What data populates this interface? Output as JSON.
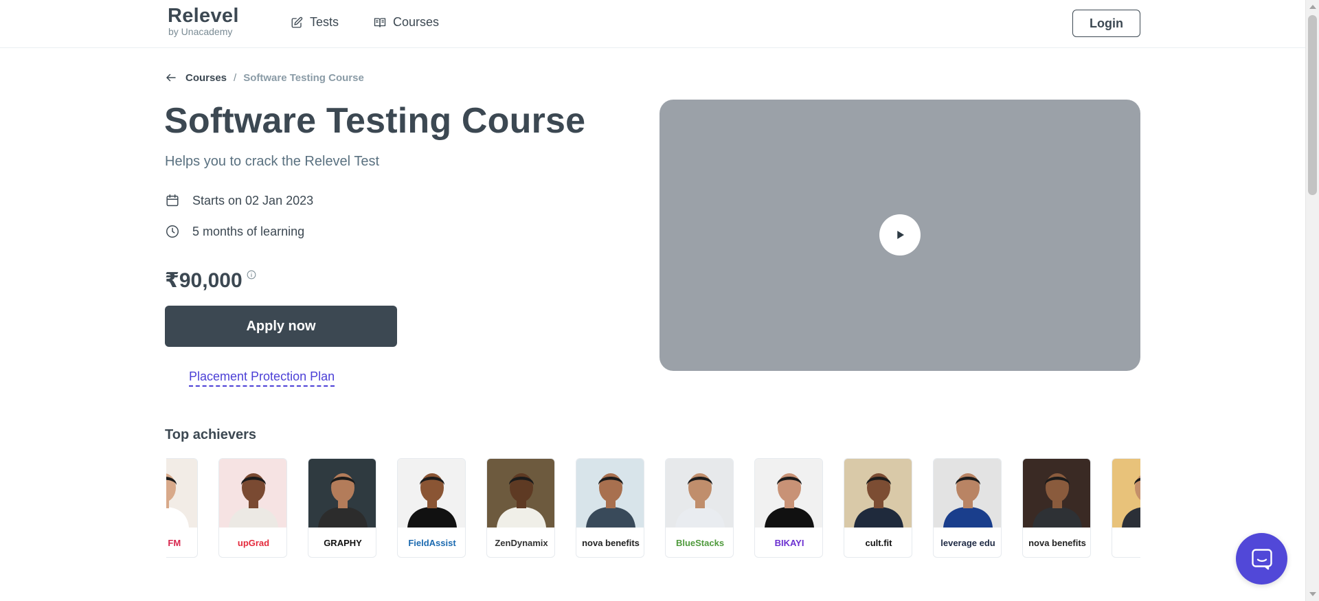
{
  "header": {
    "logo_main": "Relevel",
    "logo_sub": "by Unacademy",
    "nav": [
      {
        "label": "Tests",
        "icon": "edit-note-icon"
      },
      {
        "label": "Courses",
        "icon": "book-icon"
      }
    ],
    "login_label": "Login"
  },
  "breadcrumb": {
    "parent": "Courses",
    "separator": "/",
    "current": "Software Testing Course"
  },
  "course": {
    "title": "Software Testing Course",
    "subtitle": "Helps you to crack the Relevel Test",
    "start": "Starts on 02 Jan 2023",
    "duration": "5 months of learning",
    "price": "₹90,000",
    "apply_label": "Apply now",
    "ppp_label": "Placement Protection Plan"
  },
  "achievers": {
    "title": "Top achievers",
    "cards": [
      {
        "company": "cket FM",
        "color": "#d7264d",
        "bg": "#f2ece6",
        "skin": "#d8a98a",
        "suit": "#ffffff"
      },
      {
        "company": "upGrad",
        "color": "#e42a3c",
        "bg": "#f6e3e3",
        "skin": "#7a4a32",
        "suit": "#ece9e4"
      },
      {
        "company": "GRAPHY",
        "color": "#111111",
        "bg": "#2f3a40",
        "skin": "#b37c5a",
        "suit": "#2c2c2c"
      },
      {
        "company": "FieldAssist",
        "color": "#1c6ab0",
        "bg": "#f2f2f2",
        "skin": "#8a5534",
        "suit": "#111111"
      },
      {
        "company": "ZenDynamix",
        "color": "#333333",
        "bg": "#6d5a3e",
        "skin": "#5e3a23",
        "suit": "#f0efe8"
      },
      {
        "company": "nova benefits",
        "color": "#222222",
        "bg": "#d8e4ea",
        "skin": "#a8704f",
        "suit": "#394a5a"
      },
      {
        "company": "BlueStacks",
        "color": "#4f9a3c",
        "bg": "#e7e9eb",
        "skin": "#c08e6c",
        "suit": "#e9ecf0"
      },
      {
        "company": "BIKAYI",
        "color": "#6b2fd0",
        "bg": "#f1f1f1",
        "skin": "#c89276",
        "suit": "#111111"
      },
      {
        "company": "cult.fit",
        "color": "#111111",
        "bg": "#d9c9a8",
        "skin": "#7c4d33",
        "suit": "#1f2a3c"
      },
      {
        "company": "leverage edu",
        "color": "#1f2a44",
        "bg": "#e3e3e3",
        "skin": "#b98464",
        "suit": "#1a3e8c"
      },
      {
        "company": "nova benefits",
        "color": "#222222",
        "bg": "#3a2a24",
        "skin": "#8a5b3d",
        "suit": "#2e3135"
      },
      {
        "company": "",
        "color": "#999999",
        "bg": "#e8c27a",
        "skin": "#c48f6a",
        "suit": "#2b2f37"
      }
    ]
  },
  "colors": {
    "primary": "#3c4852",
    "accent": "#5148d8",
    "link": "#4b3fd6",
    "video_bg": "#9ba1a8"
  }
}
